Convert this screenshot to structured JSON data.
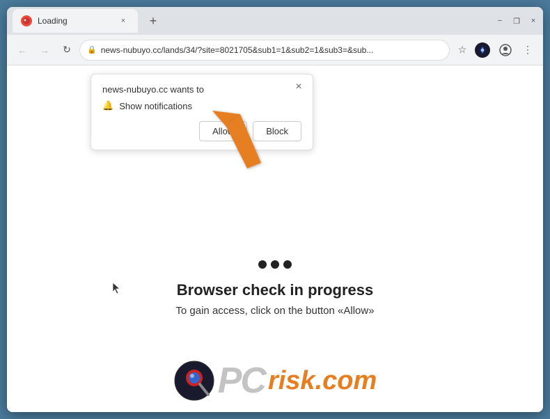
{
  "window": {
    "title": "Loading",
    "tab_close_label": "×",
    "new_tab_label": "+",
    "minimize_label": "−",
    "restore_label": "❐",
    "close_label": "×"
  },
  "address_bar": {
    "url": "news-nubuyo.cc/lands/34/?site=8021705&sub1=1&sub2=1&sub3=&sub...",
    "lock_icon": "🔒"
  },
  "notification_popup": {
    "site_text": "news-nubuyo.cc wants to",
    "permission_label": "Show notifications",
    "allow_label": "Allow",
    "block_label": "Block",
    "close_label": "×"
  },
  "page": {
    "loading_dots_count": 3,
    "check_title": "Browser check in progress",
    "check_subtitle": "To gain access, click on the button «Allow»",
    "logo_pc": "PC",
    "logo_risk": "risk",
    "logo_dot_com": ".com"
  },
  "colors": {
    "arrow_fill": "#e67e22",
    "arrow_stroke": "#cc6000",
    "background": "#4a7a9b"
  }
}
